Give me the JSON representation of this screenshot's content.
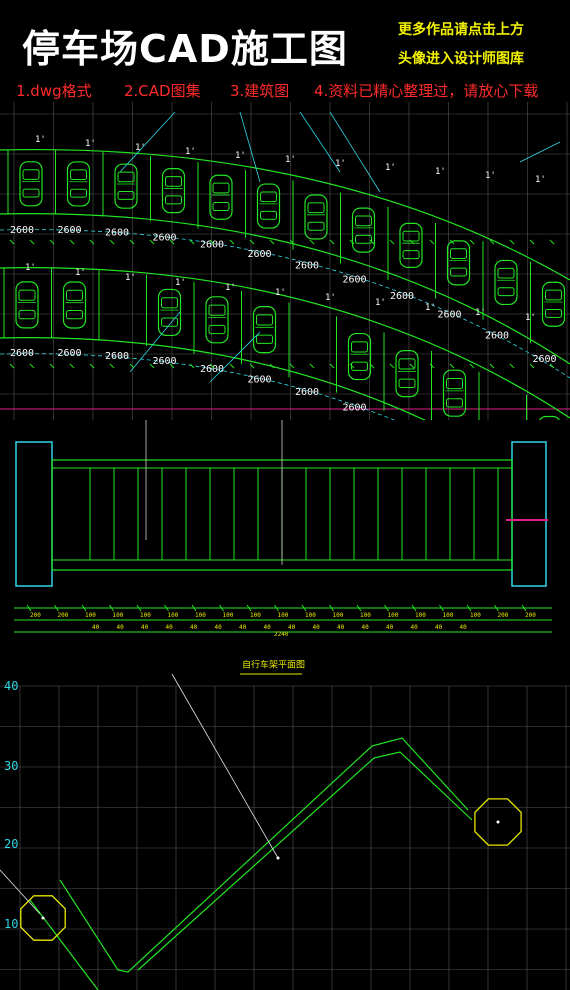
{
  "header": {
    "title": "停车场CAD施工图",
    "promo_line1": "更多作品请点击上方",
    "promo_line2": "头像进入设计师图库",
    "features": [
      "1.dwg格式",
      "2.CAD图集",
      "3.建筑图",
      "4.资料已精心整理过，请放心下载"
    ]
  },
  "plan": {
    "dim_label": "2600",
    "pitch_label": "1'"
  },
  "elevation": {
    "top_dims": [
      "200",
      "200",
      "100",
      "100",
      "100",
      "100",
      "100",
      "100",
      "100",
      "100",
      "100",
      "100",
      "100",
      "100",
      "100",
      "100",
      "100",
      "200",
      "200"
    ],
    "bottom_dims": [
      "40",
      "40",
      "40",
      "40",
      "40",
      "40",
      "40",
      "40",
      "40",
      "40",
      "40",
      "40",
      "40",
      "40",
      "40",
      "40"
    ],
    "total": "2240"
  },
  "detail": {
    "title": "自行车架平面图",
    "y_ticks": [
      "40",
      "30",
      "20",
      "10"
    ]
  },
  "colors": {
    "green": "#22e622",
    "cyan": "#2fd6e6",
    "yellow": "#e8e800",
    "magenta": "#e0208a",
    "red": "#ff2a2a",
    "grid": "#555555"
  }
}
